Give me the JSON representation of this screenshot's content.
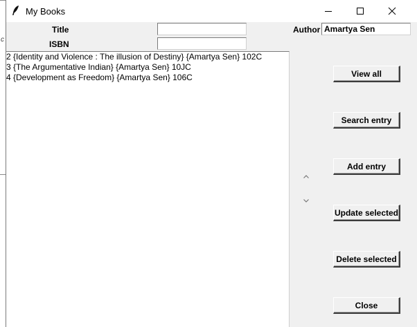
{
  "window": {
    "title": "My Books"
  },
  "form": {
    "title_label": "Title",
    "title_value": "",
    "isbn_label": "ISBN",
    "isbn_value": "",
    "author_label": "Author",
    "author_value": "Amartya Sen"
  },
  "listbox": {
    "rows": [
      "2 {Identity and Violence : The illusion of Destiny} {Amartya Sen} 102C",
      "3 {The Argumentative Indian} {Amartya Sen} 10JC",
      "4 {Development as Freedom} {Amartya Sen} 106C"
    ]
  },
  "buttons": {
    "view_all": "View all",
    "search_entry": "Search entry",
    "add_entry": "Add entry",
    "update_selected": "Update selected",
    "delete_selected": "Delete selected",
    "close": "Close"
  },
  "icons": {
    "app": "feather-icon",
    "minimize": "minimize-icon",
    "maximize": "maximize-icon",
    "close": "close-icon",
    "scroll_up": "chevron-up-icon",
    "scroll_down": "chevron-down-icon"
  }
}
